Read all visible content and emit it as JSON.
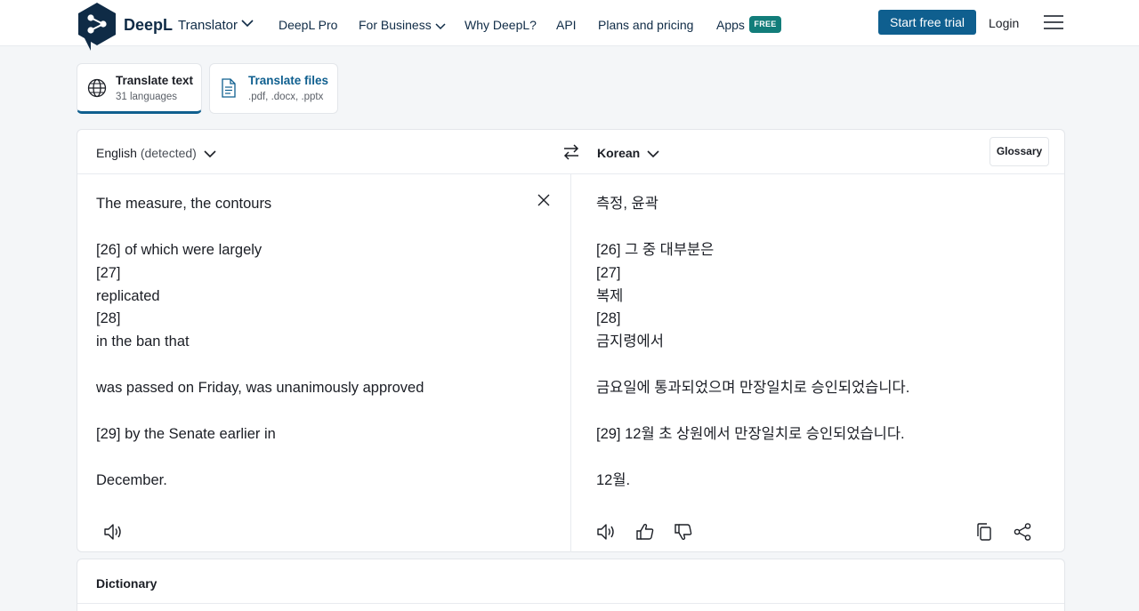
{
  "header": {
    "brand": "DeepL",
    "brand_sub": "Translator",
    "nav": [
      "DeepL Pro",
      "For Business",
      "Why DeepL?",
      "API",
      "Plans and pricing",
      "Apps"
    ],
    "free_badge": "FREE",
    "trial_button": "Start free trial",
    "login": "Login"
  },
  "tabs": [
    {
      "title": "Translate text",
      "sub": "31 languages"
    },
    {
      "title": "Translate files",
      "sub": ".pdf, .docx, .pptx"
    }
  ],
  "translator": {
    "source_lang": "English",
    "source_detected": "(detected)",
    "target_lang": "Korean",
    "glossary": "Glossary",
    "source_lines": [
      "The measure, the contours",
      "",
      "[26] of which were largely",
      "[27]",
      "replicated",
      "[28]",
      "in the ban that",
      "",
      "was passed on Friday, was unanimously approved",
      "",
      "[29] by the Senate earlier in",
      "",
      "December."
    ],
    "target_lines": [
      "측정, 윤곽",
      "",
      "[26] 그 중 대부분은",
      "[27]",
      "복제",
      "[28]",
      "금지령에서",
      "",
      "금요일에 통과되었으며 만장일치로 승인되었습니다.",
      "",
      "[29] 12월 초 상원에서 만장일치로 승인되었습니다.",
      "",
      "12월."
    ]
  },
  "dictionary": {
    "title": "Dictionary"
  },
  "colors": {
    "brand_dark": "#0f2b46",
    "accent": "#0f5f8f",
    "badge": "#127d7a"
  }
}
